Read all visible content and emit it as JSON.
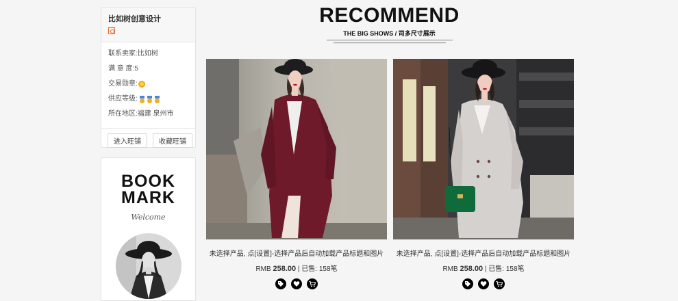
{
  "shop": {
    "name": "比如树创意设计",
    "seller_label": "联系卖家:",
    "seller_value": "比如树",
    "satisfaction_label": "满 意 度:",
    "satisfaction_value": "5",
    "trade_medal_label": "交易勋章:",
    "supply_level_label": "供应等级:",
    "region_label": "所在地区:",
    "region_value": "福建 泉州市",
    "enter_button": "进入旺铺",
    "collect_button": "收藏旺铺"
  },
  "bookmark": {
    "title_line1": "BOOK",
    "title_line2": "MARK",
    "subtitle": "Welcome"
  },
  "section": {
    "title": "RECOMMEND",
    "subtitle": "THE BIG SHOWS / 司多尺寸展示"
  },
  "products": [
    {
      "title": "未选择产品, 点[设置]-选择产品后自动加载产品标题和图片",
      "currency": "RMB",
      "price": "258.00",
      "sold_label": "已售:",
      "sold_value": "158笔"
    },
    {
      "title": "未选择产品, 点[设置]-选择产品后自动加载产品标题和图片",
      "currency": "RMB",
      "price": "258.00",
      "sold_label": "已售:",
      "sold_value": "158笔"
    }
  ],
  "icons": {
    "product_actions": [
      "tag-icon",
      "heart-icon",
      "cart-icon"
    ]
  },
  "colors": {
    "background": "#f5f5f5",
    "logo_orange": "#e46a2a",
    "coat_burgundy": "#6e1a2a",
    "coat_grey": "#d5d1cf",
    "bag_green": "#0f6b3a"
  }
}
